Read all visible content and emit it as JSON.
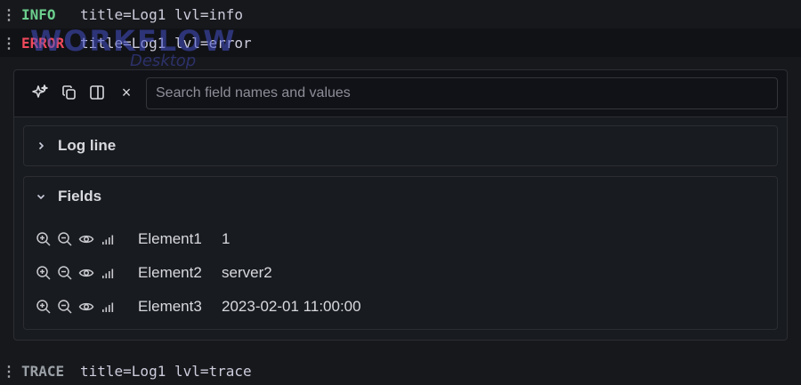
{
  "log_rows": {
    "info": {
      "level": "INFO",
      "message": "title=Log1 lvl=info"
    },
    "error": {
      "level": "ERROR",
      "message": "title=Log1 lvl=error"
    },
    "trace": {
      "level": "TRACE",
      "message": "title=Log1 lvl=trace"
    }
  },
  "watermark": {
    "main": "WORKFLOW",
    "sub": "Desktop"
  },
  "toolbar": {
    "search_placeholder": "Search field names and values",
    "close_glyph": "×"
  },
  "sections": {
    "log_line": {
      "label": "Log line",
      "expanded": false
    },
    "fields": {
      "label": "Fields",
      "expanded": true
    }
  },
  "fields": [
    {
      "name": "Element1",
      "value": "1"
    },
    {
      "name": "Element2",
      "value": "server2"
    },
    {
      "name": "Element3",
      "value": "2023-02-01 11:00:00"
    }
  ],
  "colors": {
    "info": "#6ccf8e",
    "error": "#f2495c",
    "background": "#17181c"
  }
}
